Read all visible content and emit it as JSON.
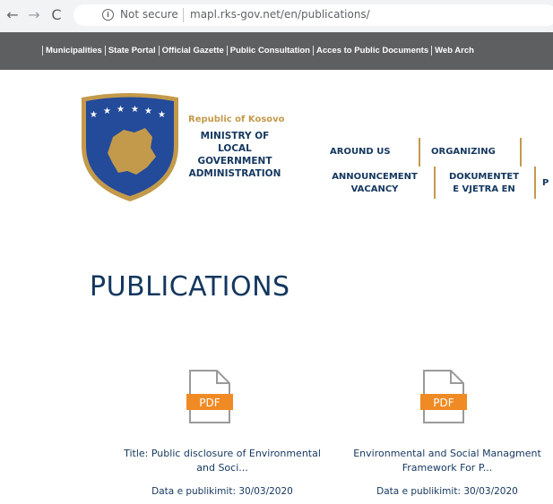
{
  "browser": {
    "security_label": "Not secure",
    "url": "mapl.rks-gov.net/en/publications/",
    "back_glyph": "←",
    "forward_glyph": "→",
    "reload_glyph": "C",
    "info_glyph": "i"
  },
  "top_links": [
    "Municipalities",
    "State Portal",
    "Official Gazette",
    "Public Consultation",
    "Acces to Public Documents",
    "Web Arch"
  ],
  "header": {
    "country": "Republic of Kosovo",
    "ministry_lines": [
      "MINISTRY OF",
      "LOCAL",
      "GOVERNMENT",
      "ADMINISTRATION"
    ]
  },
  "menu": {
    "around_us": "AROUND US",
    "organizing": "ORGANIZING",
    "announcement_lines": [
      "ANNOUNCEMENT",
      "VACANCY"
    ],
    "dokumentet_lines": [
      "DOKUMENTET",
      "E VJETRA EN"
    ],
    "truncated": "P"
  },
  "page": {
    "title": "PUBLICATIONS"
  },
  "publications": [
    {
      "title_lines": [
        "Title: Public disclosure of Environmental",
        "and Soci..."
      ],
      "date": "Data e publikimit: 30/03/2020",
      "icon_label": "PDF"
    },
    {
      "title_lines": [
        "Environmental and Social Managment",
        "Framework For P..."
      ],
      "date": "Data e publikimit: 30/03/2020",
      "icon_label": "PDF"
    }
  ],
  "colors": {
    "navy": "#14375e",
    "gold": "#c39a4b",
    "bar": "#5e5f61",
    "pdf_orange": "#f08a24",
    "shield_blue": "#244a9a"
  }
}
